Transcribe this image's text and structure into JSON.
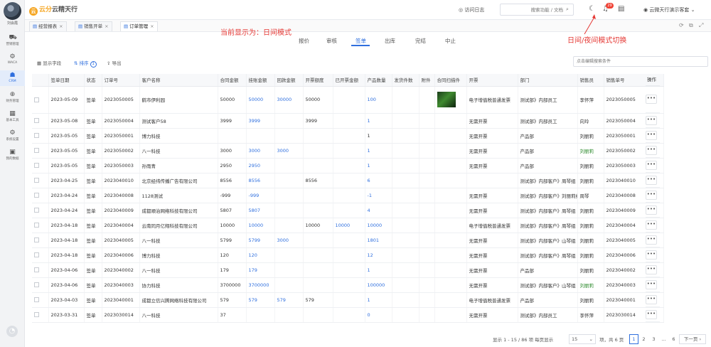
{
  "user": {
    "name": "刘会霞"
  },
  "sidebar": {
    "items": [
      {
        "label": "营销管理",
        "icon": "truck-icon"
      },
      {
        "label": "WACA",
        "icon": "gear-icon"
      },
      {
        "label": "CRM",
        "icon": "crm-icon"
      },
      {
        "label": "财务管理",
        "icon": "finance-icon"
      },
      {
        "label": "基本工具",
        "icon": "tools-icon"
      },
      {
        "label": "系统设置",
        "icon": "settings-icon"
      },
      {
        "label": "我的数据",
        "icon": "data-icon"
      }
    ]
  },
  "header": {
    "logo_mark": "云",
    "logo_brand": "云分",
    "logo_text": "云精天行",
    "visit_label": "访问日志",
    "search_placeholder": "搜索功能 / 文档",
    "notification_count": "29",
    "account_name": "云微天行演示客套"
  },
  "tabs": [
    {
      "label": "经营报表",
      "active": false
    },
    {
      "label": "销售开单",
      "active": false
    },
    {
      "label": "订单管理",
      "active": true
    }
  ],
  "annotations": {
    "day_mode": "当前显示为：日间模式",
    "toggle_hint": "日间/夜间模式切换"
  },
  "status_tabs": [
    "报价",
    "审核",
    "签单",
    "出库",
    "完结",
    "中止"
  ],
  "toolbar": {
    "show_fields": "显示字段",
    "sort_label": "排序",
    "sort_count": "1",
    "export_label": "导出",
    "filter_placeholder": "点击编辑搜索条件"
  },
  "table": {
    "headers": [
      "签单日期",
      "状态",
      "订单号",
      "客户名称",
      "合同金额",
      "挂账金额",
      "回款金额",
      "开票额度",
      "已开票金额",
      "产品数量",
      "发货件数",
      "附件",
      "合同扫描件",
      "开票",
      "部门",
      "销售员",
      "销售单号",
      "操作"
    ],
    "rows": [
      [
        "2023-05-09",
        "签单",
        "2023050005",
        "鹤市伊利园",
        "50000",
        "50000",
        "30000",
        "50000",
        "",
        "100",
        "",
        "",
        "thumb",
        "电子增值税普通发票",
        "测试部》内部员工",
        "李怀萍",
        "2023050005"
      ],
      [
        "2023-05-08",
        "签单",
        "2023050004",
        "测试客户58",
        "3999",
        "3999",
        "",
        "3999",
        "",
        "1",
        "",
        "",
        "",
        "无需开票",
        "测试部》内部员工",
        "向玲",
        "2023050004"
      ],
      [
        "2023-05-05",
        "签单",
        "2023050001",
        "博力科技",
        "",
        "",
        "",
        "",
        "",
        "1",
        "",
        "",
        "",
        "无需开票",
        "产品部",
        "刘丽莉",
        "2023050001"
      ],
      [
        "2023-05-05",
        "签单",
        "2023050002",
        "八一科技",
        "3000",
        "3000",
        "3000",
        "",
        "",
        "1",
        "",
        "",
        "",
        "无需开票",
        "产品部",
        "刘丽莉",
        "2023050002"
      ],
      [
        "2023-05-05",
        "签单",
        "2023050003",
        "孙雨青",
        "2950",
        "2950",
        "",
        "",
        "",
        "1",
        "",
        "",
        "",
        "无需开票",
        "产品部",
        "刘丽莉",
        "2023050003"
      ],
      [
        "2023-04-25",
        "签单",
        "2023040010",
        "北京经纬传播广告有限公司",
        "8556",
        "8556",
        "",
        "8556",
        "",
        "6",
        "",
        "",
        "",
        "",
        "测试部》内部客户》周琴组",
        "刘丽莉",
        "2023040010"
      ],
      [
        "2023-04-24",
        "签单",
        "2023040008",
        "1128测试",
        "-999",
        "-999",
        "",
        "",
        "",
        "-1",
        "",
        "",
        "",
        "无需开票",
        "测试部》内部客户》刘丽莉组",
        "周琴",
        "2023040008"
      ],
      [
        "2023-04-24",
        "签单",
        "2023040009",
        "成都顺治网络科技有限公司",
        "5807",
        "5807",
        "",
        "",
        "",
        "4",
        "",
        "",
        "",
        "无需开票",
        "测试部》内部客户》周琴组",
        "刘丽莉",
        "2023040009"
      ],
      [
        "2023-04-18",
        "签单",
        "2023040004",
        "云南同月亿翔科技有限公司",
        "10000",
        "10000",
        "",
        "10000",
        "10000",
        "10000",
        "",
        "",
        "",
        "电子增值税普通发票",
        "测试部》内部客户》周琴组",
        "刘丽莉",
        "2023040004"
      ],
      [
        "2023-04-18",
        "签单",
        "2023040005",
        "八一科技",
        "5799",
        "5799",
        "3000",
        "",
        "",
        "1801",
        "",
        "",
        "",
        "无需开票",
        "测试部》内部客户》山琴组",
        "刘丽莉",
        "2023040005"
      ],
      [
        "2023-04-18",
        "签单",
        "2023040006",
        "博力科技",
        "120",
        "120",
        "",
        "",
        "",
        "12",
        "",
        "",
        "",
        "无需开票",
        "测试部》内部客户》周琴组",
        "刘丽莉",
        "2023040006"
      ],
      [
        "2023-04-06",
        "签单",
        "2023040002",
        "八一科技",
        "179",
        "179",
        "",
        "",
        "",
        "1",
        "",
        "",
        "",
        "无需开票",
        "产品部",
        "刘丽莉",
        "2023040002"
      ],
      [
        "2023-04-06",
        "签单",
        "2023040003",
        "协力科技",
        "3700000",
        "3700000",
        "",
        "",
        "",
        "100000",
        "",
        "",
        "",
        "无需开票",
        "测试部》内部客户》山琴组",
        "刘丽莉",
        "2023040003"
      ],
      [
        "2023-04-03",
        "签单",
        "2023040001",
        "成都立信兴腾网络科技有限公司",
        "579",
        "579",
        "579",
        "579",
        "",
        "1",
        "",
        "",
        "",
        "电子增值税普通发票",
        "产品部",
        "刘丽莉",
        "2023040001"
      ],
      [
        "2023-03-31",
        "签单",
        "2023030014",
        "八一科技",
        "37",
        "",
        "",
        "",
        "",
        "0",
        "",
        "",
        "",
        "无需开票",
        "测试部》内部员工",
        "李怀萍",
        "2023030014"
      ]
    ]
  },
  "pagination": {
    "summary": "显示 1 - 15 / 86 项  每页显示",
    "page_size": "15",
    "total_pages": "项，共 6 页",
    "pages": [
      "1",
      "2",
      "3",
      "...",
      "6"
    ],
    "next_label": "下一页"
  }
}
